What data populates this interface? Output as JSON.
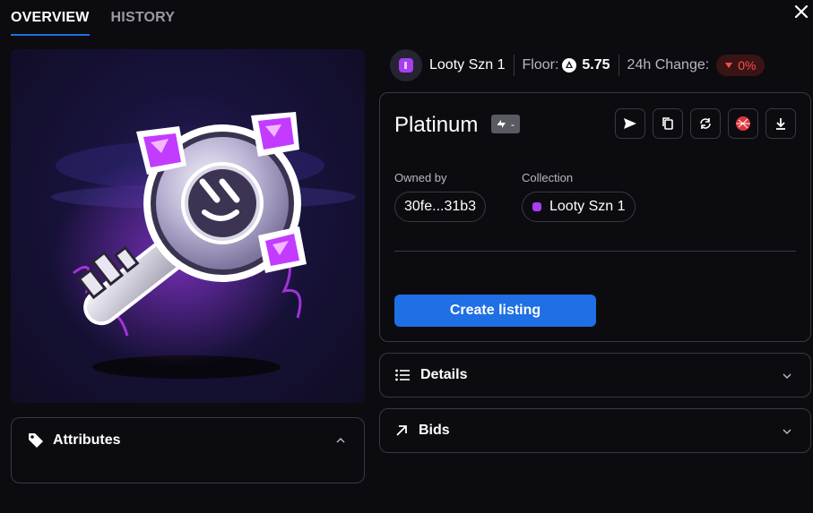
{
  "tabs": {
    "overview": "OVERVIEW",
    "history": "HISTORY"
  },
  "collection_bar": {
    "name": "Looty Szn 1",
    "floor_label": "Floor:",
    "floor_value": "5.75",
    "change_label": "24h Change:",
    "change_value": "0%",
    "change_color": "#ff4d4d"
  },
  "item": {
    "title": "Platinum",
    "rank": "-",
    "owned_by_label": "Owned by",
    "owner": "30fe...31b3",
    "collection_label": "Collection",
    "collection": "Looty Szn 1",
    "create_listing": "Create listing",
    "actions": [
      "send-icon",
      "copy-icon",
      "refresh-icon",
      "dribbble-icon",
      "download-icon"
    ]
  },
  "sections": {
    "details": "Details",
    "bids": "Bids",
    "attributes": "Attributes"
  },
  "colors": {
    "accent": "#1f6fe5",
    "gem": "#c23bff",
    "badge": "#5a5a62"
  }
}
